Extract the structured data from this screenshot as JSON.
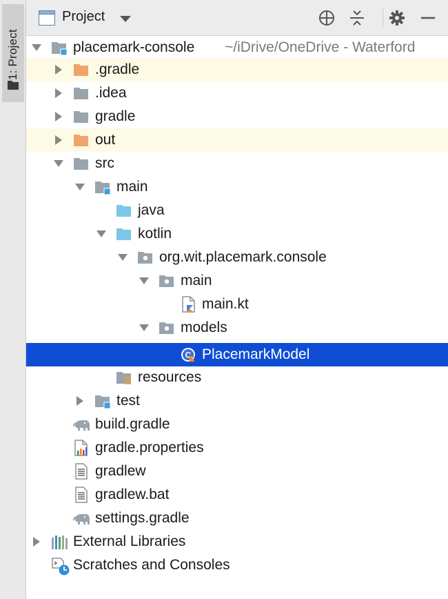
{
  "toolwindow": {
    "strip_label": "1: Project"
  },
  "header": {
    "title": "Project",
    "buttons": [
      "locate-icon",
      "collapse-all-icon",
      "settings-icon",
      "hide-icon"
    ]
  },
  "tree": {
    "rows": [
      {
        "label": "placemark-console",
        "hint": "~/iDrive/OneDrive - Waterford",
        "icon": "module-folder-icon",
        "expanded": true
      },
      {
        "label": ".gradle",
        "icon": "excluded-folder-icon",
        "expanded": false
      },
      {
        "label": ".idea",
        "icon": "folder-icon",
        "expanded": false
      },
      {
        "label": "gradle",
        "icon": "folder-icon",
        "expanded": false
      },
      {
        "label": "out",
        "icon": "excluded-folder-icon",
        "expanded": false
      },
      {
        "label": "src",
        "icon": "folder-icon",
        "expanded": true
      },
      {
        "label": "main",
        "icon": "module-folder-icon",
        "expanded": true
      },
      {
        "label": "java",
        "icon": "source-folder-icon"
      },
      {
        "label": "kotlin",
        "icon": "source-folder-icon",
        "expanded": true
      },
      {
        "label": "org.wit.placemark.console",
        "icon": "package-icon",
        "expanded": true
      },
      {
        "label": "main",
        "icon": "package-icon",
        "expanded": true
      },
      {
        "label": "main.kt",
        "icon": "kotlin-file-icon"
      },
      {
        "label": "models",
        "icon": "package-icon",
        "expanded": true
      },
      {
        "label": "PlacemarkModel",
        "icon": "kotlin-class-icon",
        "selected": true
      },
      {
        "label": "resources",
        "icon": "resources-folder-icon"
      },
      {
        "label": "test",
        "icon": "module-folder-icon",
        "expanded": false
      },
      {
        "label": "build.gradle",
        "icon": "gradle-file-icon"
      },
      {
        "label": "gradle.properties",
        "icon": "properties-file-icon"
      },
      {
        "label": "gradlew",
        "icon": "text-file-icon"
      },
      {
        "label": "gradlew.bat",
        "icon": "text-file-icon"
      },
      {
        "label": "settings.gradle",
        "icon": "gradle-file-icon"
      },
      {
        "label": "External Libraries",
        "icon": "libraries-icon",
        "expanded": false
      },
      {
        "label": "Scratches and Consoles",
        "icon": "scratches-icon"
      }
    ]
  },
  "colors": {
    "selection": "#0f4dd4",
    "excluded_highlight": "#fdfbe5",
    "folder_gray": "#9aa4ad",
    "folder_orange": "#f0a36b",
    "source_blue": "#7cc7e9"
  }
}
